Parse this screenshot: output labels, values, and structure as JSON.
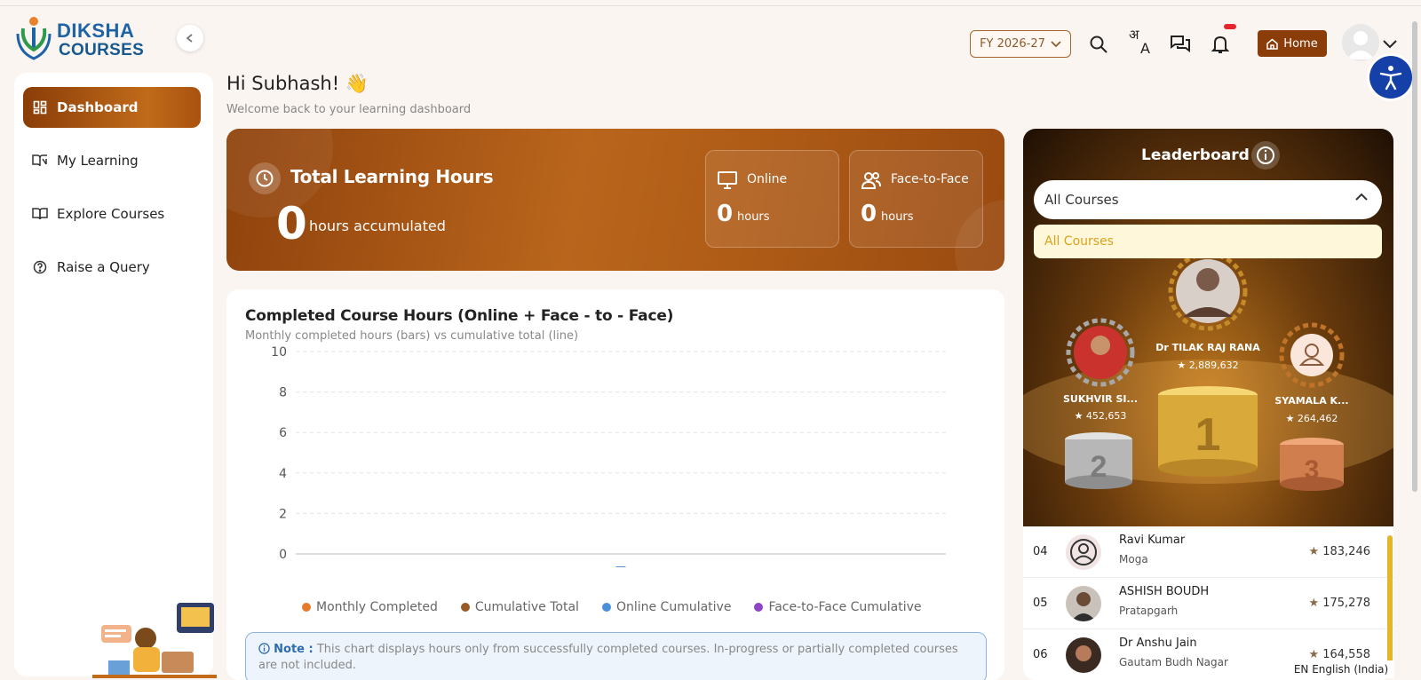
{
  "brand": {
    "line1": "DIKSHA",
    "line2": "COURSES"
  },
  "sidebar": {
    "items": [
      {
        "label": "Dashboard",
        "icon": "dashboard-icon",
        "active": true
      },
      {
        "label": "My Learning",
        "icon": "book-open-icon",
        "active": false
      },
      {
        "label": "Explore Courses",
        "icon": "book-icon",
        "active": false
      },
      {
        "label": "Raise a Query",
        "icon": "help-circle-icon",
        "active": false
      }
    ]
  },
  "header": {
    "fy_label": "FY 2026-27",
    "home_label": "Home",
    "icons": [
      "search-icon",
      "translate-icon",
      "chat-icon",
      "bell-icon",
      "home-icon",
      "user-avatar",
      "chevron-down-icon",
      "accessibility-icon"
    ]
  },
  "greeting": {
    "title": "Hi Subhash! 👋",
    "subtitle": "Welcome back to your learning dashboard"
  },
  "hours": {
    "title": "Total Learning Hours",
    "total": "0",
    "total_unit": "hours accumulated",
    "online": {
      "label": "Online",
      "value": "0",
      "unit": "hours"
    },
    "face": {
      "label": "Face-to-Face",
      "value": "0",
      "unit": "hours"
    }
  },
  "chart": {
    "title": "Completed Course Hours (Online + Face - to - Face)",
    "subtitle": "Monthly completed hours (bars) vs cumulative total (line)",
    "note_label": "Note :",
    "note_text": "This chart displays hours only from successfully completed courses. In-progress or partially completed courses are not included."
  },
  "chart_data": {
    "type": "bar",
    "categories": [
      "—"
    ],
    "series": [
      {
        "name": "Monthly Completed",
        "values": [
          0
        ],
        "color": "#e47b2c"
      },
      {
        "name": "Cumulative Total",
        "values": [
          0
        ],
        "color": "#9a5a25"
      },
      {
        "name": "Online Cumulative",
        "values": [
          0
        ],
        "color": "#4a90d9"
      },
      {
        "name": "Face-to-Face Cumulative",
        "values": [
          0
        ],
        "color": "#8e44c4"
      }
    ],
    "yticks": [
      "10",
      "8",
      "6",
      "4",
      "2",
      "0"
    ],
    "ylim": [
      0,
      10
    ],
    "grid": true,
    "legend": "bottom"
  },
  "leaderboard": {
    "title": "Leaderboard",
    "filter_value": "All Courses",
    "option": "All Courses",
    "podium": [
      {
        "rank": "1",
        "name": "Dr TILAK RAJ RANA",
        "score": "2,889,632"
      },
      {
        "rank": "2",
        "name": "SUKHVIR SI...",
        "score": "452,653"
      },
      {
        "rank": "3",
        "name": "SYAMALA K...",
        "score": "264,462"
      }
    ],
    "rows": [
      {
        "rank": "04",
        "name": "Ravi Kumar",
        "city": "Moga",
        "score": "183,246"
      },
      {
        "rank": "05",
        "name": "ASHISH BOUDH",
        "city": "Pratapgarh",
        "score": "175,278"
      },
      {
        "rank": "06",
        "name": "Dr Anshu Jain",
        "city": "Gautam Budh Nagar",
        "score": "164,558"
      }
    ]
  },
  "language": "EN English (India)"
}
